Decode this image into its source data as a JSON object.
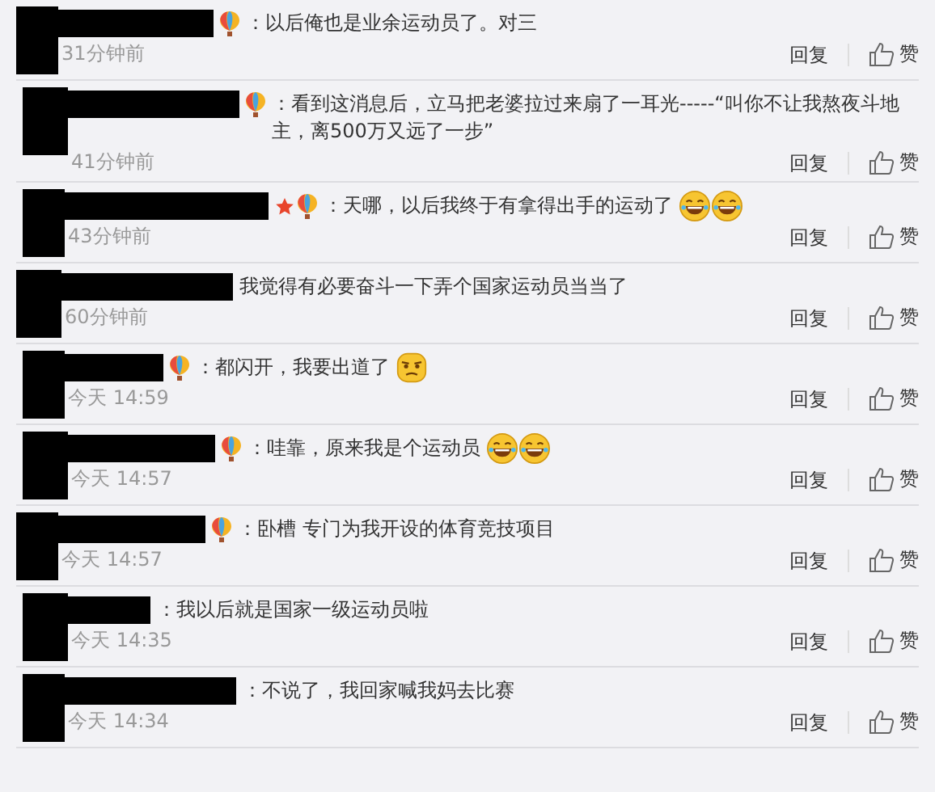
{
  "comments": [
    {
      "badges": [
        {
          "kind": "balloon"
        }
      ],
      "text": "：以后俺也是业余运动员了。对三",
      "time": "31分钟前",
      "reply": "回复",
      "like": "赞"
    },
    {
      "badges": [
        {
          "kind": "balloon"
        }
      ],
      "text": "：看到这消息后，立马把老婆拉过来扇了一耳光-----“叫你不让我熬夜斗地主，离500万又远了一步”",
      "time": "41分钟前",
      "reply": "回复",
      "like": "赞"
    },
    {
      "badges": [
        {
          "kind": "star"
        },
        {
          "kind": "balloon"
        }
      ],
      "text": "：天哪，以后我终于有拿得出手的运动了",
      "emoji": [
        {
          "kind": "laugh"
        },
        {
          "kind": "laugh"
        }
      ],
      "time": "43分钟前",
      "reply": "回复",
      "like": "赞"
    },
    {
      "text": "我觉得有必要奋斗一下弄个国家运动员当当了",
      "time": "60分钟前",
      "reply": "回复",
      "like": "赞"
    },
    {
      "badges": [
        {
          "kind": "balloon"
        }
      ],
      "text": "：都闪开，我要出道了",
      "emoji": [
        {
          "kind": "smug"
        }
      ],
      "time": "今天 14:59",
      "reply": "回复",
      "like": "赞"
    },
    {
      "badges": [
        {
          "kind": "balloon"
        }
      ],
      "text": "：哇靠，原来我是个运动员",
      "emoji": [
        {
          "kind": "laugh"
        },
        {
          "kind": "laugh"
        }
      ],
      "time": "今天 14:57",
      "reply": "回复",
      "like": "赞"
    },
    {
      "badges": [
        {
          "kind": "balloon"
        }
      ],
      "text": "：卧槽 专门为我开设的体育竞技项目",
      "time": "今天 14:57",
      "reply": "回复",
      "like": "赞"
    },
    {
      "text": "：我以后就是国家一级运动员啦",
      "time": "今天 14:35",
      "reply": "回复",
      "like": "赞"
    },
    {
      "text": "：不说了，我回家喊我妈去比赛",
      "time": "今天 14:34",
      "reply": "回复",
      "like": "赞"
    }
  ]
}
